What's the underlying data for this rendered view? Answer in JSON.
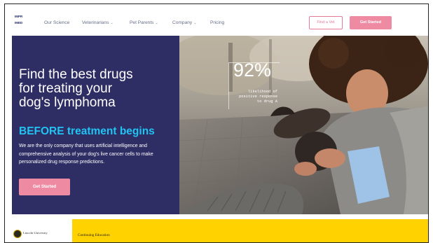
{
  "nav": {
    "logo_lines": [
      "IMPR",
      "IMED"
    ],
    "links": [
      {
        "label": "Our Science",
        "dropdown": false
      },
      {
        "label": "Veterinarians",
        "dropdown": true
      },
      {
        "label": "Pet Parents",
        "dropdown": true
      },
      {
        "label": "Company",
        "dropdown": true
      },
      {
        "label": "Pricing",
        "dropdown": false
      }
    ],
    "find_vet_label": "Find a Vet",
    "get_started_label": "Get Started"
  },
  "hero": {
    "headline_lines": [
      "Find the best drugs",
      "for treating your",
      "dog's lymphoma"
    ],
    "subheadline": "BEFORE treatment begins",
    "paragraph": "We are the only company that uses artificial intelligence and comprehensive analysis of your dog's live cancer cells to make personalized drug response predictions.",
    "cta_label": "Get Started",
    "stat_value": "92%",
    "stat_caption_lines": [
      "likelihood of",
      "positive response",
      "to drug A"
    ]
  },
  "footer": {
    "university_name": "Lincoln University",
    "banner_text": "Continuing Education"
  },
  "colors": {
    "hero_bg": "#2e2d64",
    "accent_pink": "#ef8aa3",
    "accent_cyan": "#21c3f3",
    "banner_yellow": "#ffd200"
  }
}
